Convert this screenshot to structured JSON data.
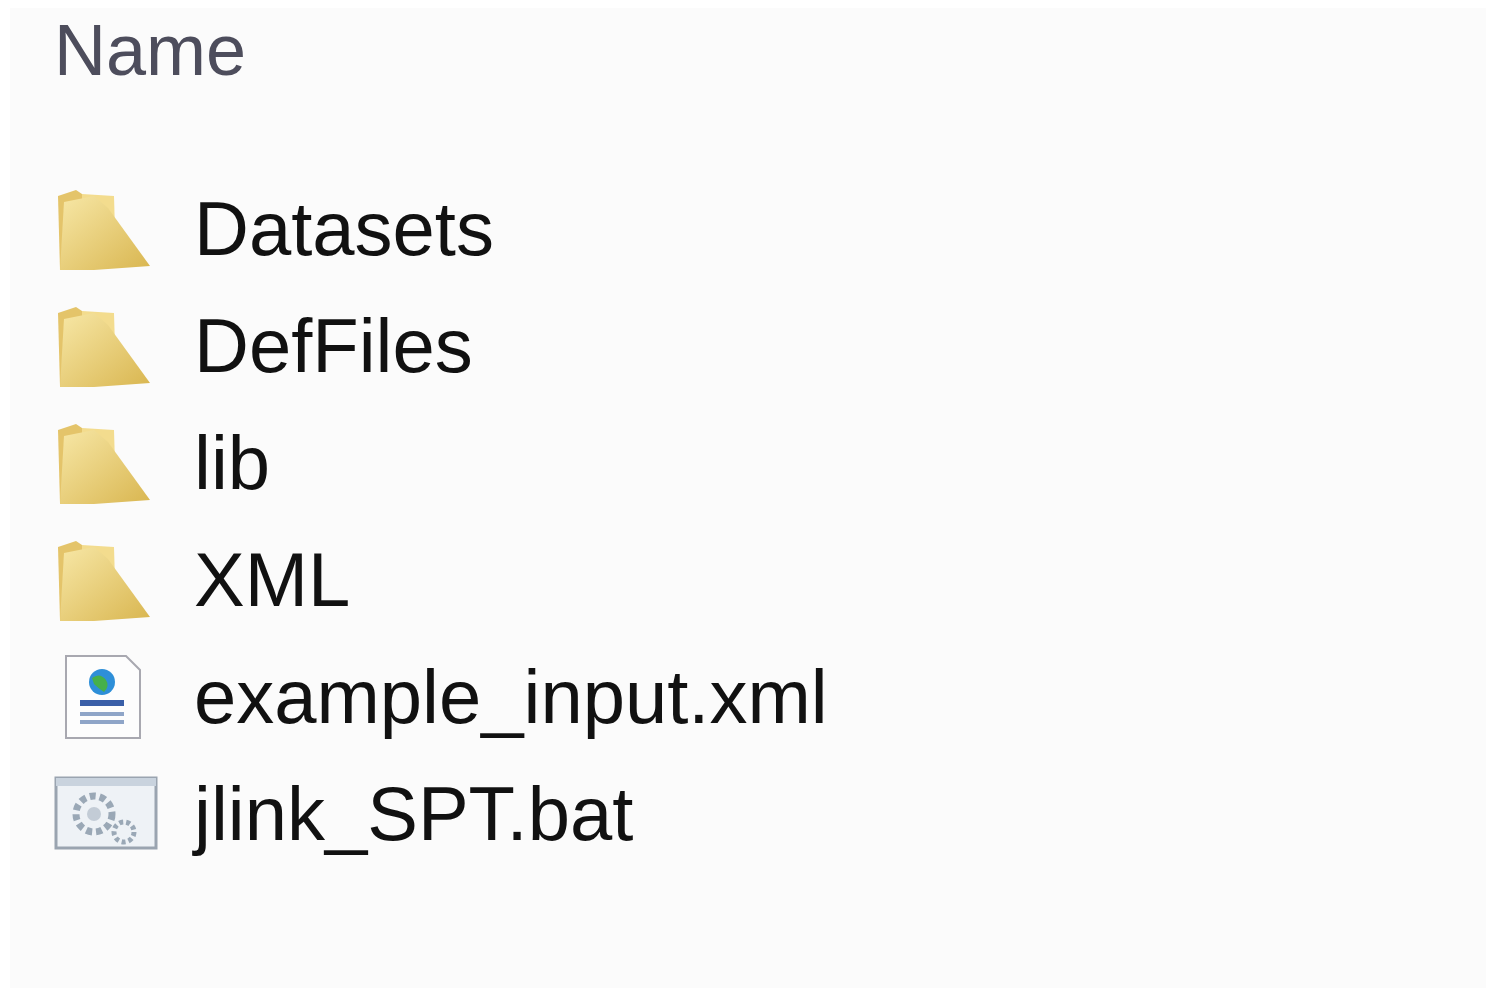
{
  "header": {
    "column": "Name"
  },
  "files": [
    {
      "name": "Datasets",
      "kind": "folder"
    },
    {
      "name": "DefFiles",
      "kind": "folder"
    },
    {
      "name": "lib",
      "kind": "folder"
    },
    {
      "name": "XML",
      "kind": "folder"
    },
    {
      "name": "example_input.xml",
      "kind": "xml"
    },
    {
      "name": "jlink_SPT.bat",
      "kind": "bat"
    }
  ]
}
